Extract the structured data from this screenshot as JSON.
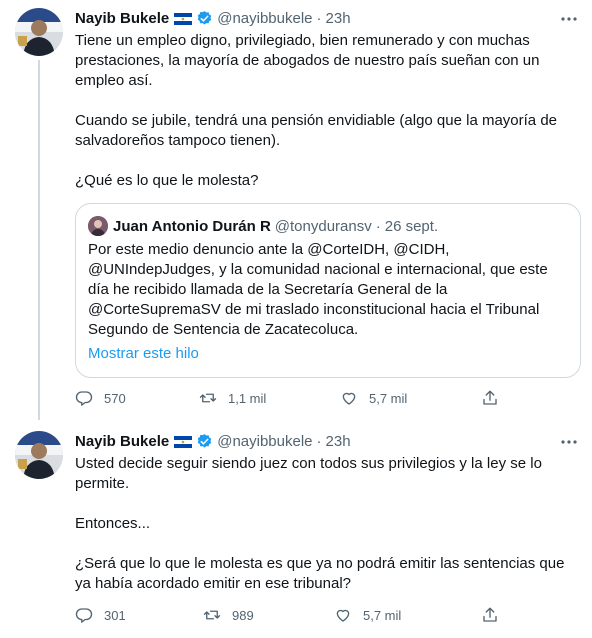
{
  "tweets": [
    {
      "author": "Nayib Bukele",
      "handle": "@nayibbukele",
      "time": "23h",
      "paragraphs": [
        "Tiene un empleo digno, privilegiado, bien remunerado y con muchas prestaciones, la mayoría de abogados de nuestro país sueñan con un empleo así.",
        "Cuando se jubile, tendrá una pensión envidiable (algo que la mayoría de salvadoreños tampoco tienen).",
        "¿Qué es lo que le molesta?"
      ],
      "quote": {
        "author": "Juan Antonio Durán R",
        "handle": "@tonyduransv",
        "time": "26 sept.",
        "text": "Por este medio denuncio ante la @CorteIDH, @CIDH, @UNIndepJudges, y la comunidad nacional e internacional,  que este día he recibido llamada de la Secretaría General de la @CorteSupremaSV de mi traslado inconstitucional hacia el Tribunal Segundo de Sentencia de Zacatecoluca.",
        "show_thread": "Mostrar este hilo"
      },
      "replies": "570",
      "retweets": "1,1 mil",
      "likes": "5,7 mil"
    },
    {
      "author": "Nayib Bukele",
      "handle": "@nayibbukele",
      "time": "23h",
      "paragraphs": [
        "Usted decide seguir siendo juez con todos sus privilegios y la ley se lo permite.",
        "Entonces...",
        "¿Será que lo que le molesta es que ya no podrá emitir las sentencias que ya había acordado emitir en ese tribunal?"
      ],
      "replies": "301",
      "retweets": "989",
      "likes": "5,7 mil"
    }
  ],
  "colors": {
    "text": "#0f1419",
    "secondary": "#536471",
    "link": "#1d9bf0",
    "verified": "#1d9bf0",
    "border": "#cfd9de"
  },
  "icons": [
    "verified-icon",
    "flag-icon",
    "more-icon",
    "reply-icon",
    "retweet-icon",
    "like-icon",
    "share-icon"
  ]
}
